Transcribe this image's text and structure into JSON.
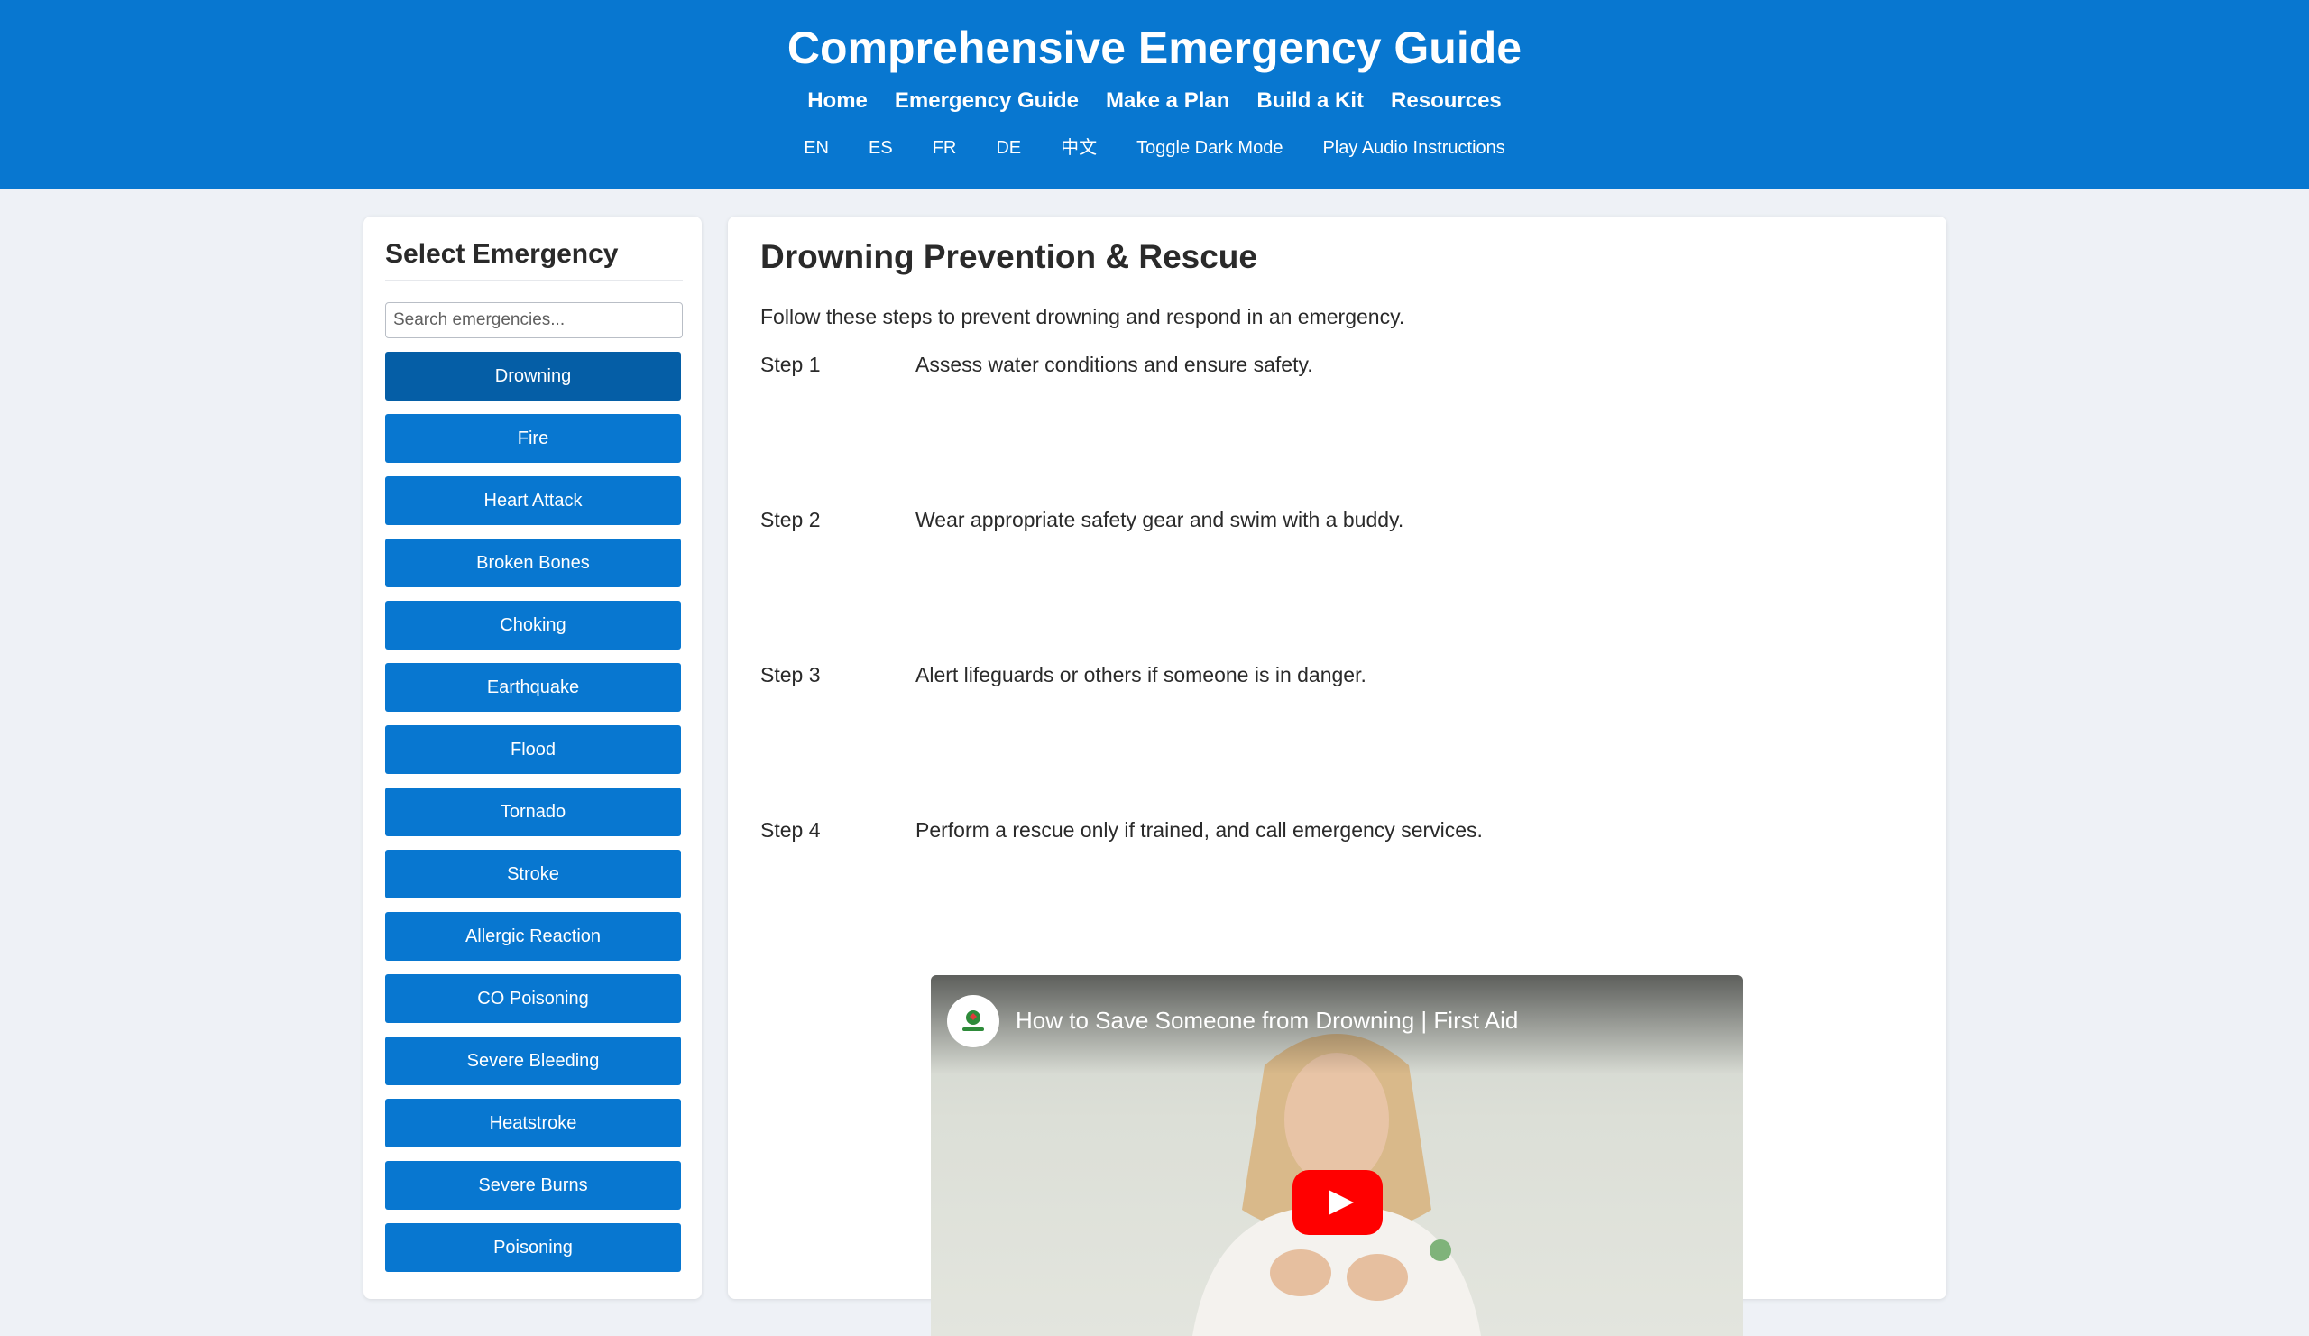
{
  "header": {
    "title": "Comprehensive Emergency Guide",
    "nav": [
      "Home",
      "Emergency Guide",
      "Make a Plan",
      "Build a Kit",
      "Resources"
    ],
    "tools": [
      "EN",
      "ES",
      "FR",
      "DE",
      "中文",
      "Toggle Dark Mode",
      "Play Audio Instructions"
    ]
  },
  "sidebar": {
    "title": "Select Emergency",
    "search_placeholder": "Search emergencies...",
    "items": [
      "Drowning",
      "Fire",
      "Heart Attack",
      "Broken Bones",
      "Choking",
      "Earthquake",
      "Flood",
      "Tornado",
      "Stroke",
      "Allergic Reaction",
      "CO Poisoning",
      "Severe Bleeding",
      "Heatstroke",
      "Severe Burns",
      "Poisoning"
    ],
    "active": "Drowning"
  },
  "content": {
    "title": "Drowning Prevention & Rescue",
    "intro": "Follow these steps to prevent drowning and respond in an emergency.",
    "steps": [
      {
        "label": "Step 1",
        "text": "Assess water conditions and ensure safety."
      },
      {
        "label": "Step 2",
        "text": "Wear appropriate safety gear and swim with a buddy."
      },
      {
        "label": "Step 3",
        "text": "Alert lifeguards or others if someone is in danger."
      },
      {
        "label": "Step 4",
        "text": "Perform a rescue only if trained, and call emergency services."
      }
    ],
    "video": {
      "title": "How to Save Someone from Drowning | First Aid",
      "play_icon": "youtube-play-icon"
    }
  },
  "colors": {
    "header_bg": "#0877d0",
    "button_bg": "#0877d0",
    "button_active_bg": "#055ea6",
    "page_bg": "#eef1f6",
    "play_red": "#ff0000"
  }
}
